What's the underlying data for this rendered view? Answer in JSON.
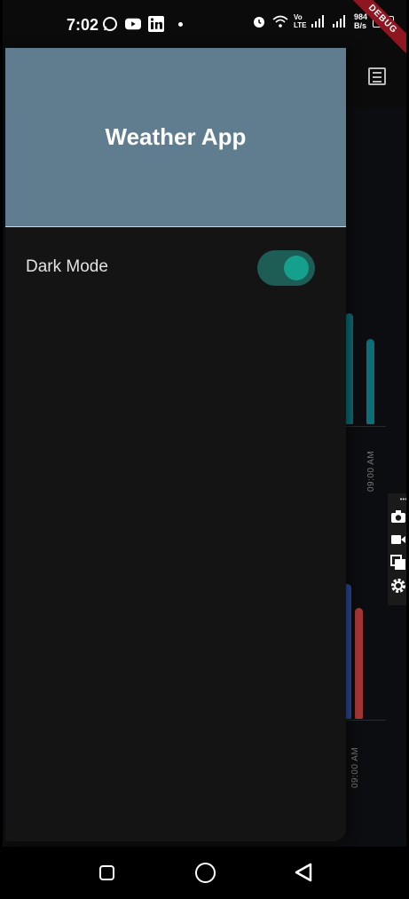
{
  "status_bar": {
    "time": "7:02",
    "net_speed_top": "984",
    "net_speed_bottom": "B/s",
    "network_label": "Vo LTE",
    "battery": "24",
    "debug_banner": "DEBUG"
  },
  "drawer": {
    "title": "Weather App",
    "items": [
      {
        "label": "Dark Mode",
        "toggle_on": true
      }
    ]
  },
  "background_chart": {
    "time_labels": [
      "09:00 AM",
      "09:00 AM"
    ],
    "colors": {
      "teal": "#0b7c87",
      "blue": "#2c4a9a",
      "red": "#a53535"
    }
  },
  "colors": {
    "header": "#5f7d8e",
    "drawer_bg": "#141414",
    "switch_track": "#1d5d56",
    "switch_knob": "#15a08e"
  },
  "icons": {
    "app_bar_action": "list-icon",
    "tools": [
      "camera-icon",
      "video-icon",
      "copy-icon",
      "settings-icon"
    ],
    "nav": [
      "recent-apps-icon",
      "home-icon",
      "back-icon"
    ]
  }
}
